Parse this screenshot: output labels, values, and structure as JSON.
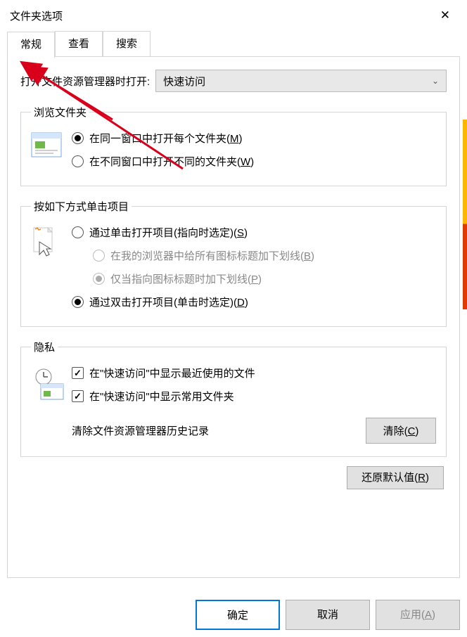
{
  "window": {
    "title": "文件夹选项",
    "close": "✕"
  },
  "tabs": {
    "general": "常规",
    "view": "查看",
    "search": "搜索"
  },
  "open_with": {
    "label": "打开文件资源管理器时打开:",
    "value": "快速访问"
  },
  "browse": {
    "legend": "浏览文件夹",
    "same_window": "在同一窗口中打开每个文件夹(",
    "same_window_k": "M",
    "diff_window": "在不同窗口中打开不同的文件夹(",
    "diff_window_k": "W"
  },
  "click": {
    "legend": "按如下方式单击项目",
    "single": "通过单击打开项目(指向时选定)(",
    "single_k": "S",
    "underline_all": "在我的浏览器中给所有图标标题加下划线(",
    "underline_all_k": "B",
    "underline_point": "仅当指向图标标题时加下划线(",
    "underline_point_k": "P",
    "dbl": "通过双击打开项目(单击时选定)(",
    "dbl_k": "D"
  },
  "privacy": {
    "legend": "隐私",
    "recent": "在\"快速访问\"中显示最近使用的文件",
    "frequent": "在\"快速访问\"中显示常用文件夹",
    "clear_label": "清除文件资源管理器历史记录",
    "clear_btn": "清除(",
    "clear_btn_k": "C"
  },
  "restore": {
    "label": "还原默认值(",
    "k": "R"
  },
  "footer": {
    "ok": "确定",
    "cancel": "取消",
    "apply": "应用(",
    "apply_k": "A"
  }
}
